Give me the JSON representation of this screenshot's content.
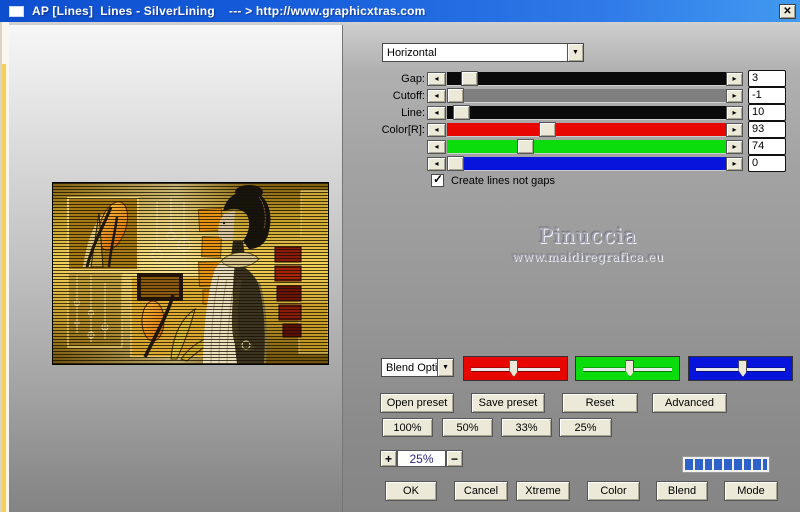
{
  "titlebar": {
    "title": "AP [Lines]  Lines - SilverLining    --- > http://www.graphicxtras.com",
    "close_glyph": "✕"
  },
  "mode_select": {
    "value": "Horizontal",
    "arrow_glyph": "▼"
  },
  "sliders": {
    "left_arrow_glyph": "◂",
    "right_arrow_glyph": "▸",
    "rows": [
      {
        "label": "Gap:",
        "value": "3",
        "color": "#0a0a0a",
        "thumb_left": "5%"
      },
      {
        "label": "Cutoff:",
        "value": "-1",
        "color": "#7f7f7f",
        "thumb_left": "0%"
      },
      {
        "label": "Line:",
        "value": "10",
        "color": "#0a0a0a",
        "thumb_left": "2%"
      },
      {
        "label": "Color[R]:",
        "value": "93",
        "color": "#e80600",
        "thumb_left": "33%"
      },
      {
        "label": "",
        "value": "74",
        "color": "#0bdc0b",
        "thumb_left": "25%"
      },
      {
        "label": "",
        "value": "0",
        "color": "#0614dc",
        "thumb_left": "0%"
      }
    ]
  },
  "options": {
    "create_lines_label": "Create lines not gaps",
    "checked": true,
    "check_glyph": "✓"
  },
  "watermark": {
    "name": "Pinuccia",
    "site": "www.maidiregrafica.eu"
  },
  "blend": {
    "select_value": "Blend Opti",
    "arrow_glyph": "▼",
    "channels": [
      {
        "name": "red",
        "color": "#e80600",
        "thumb_left": "44%"
      },
      {
        "name": "green",
        "color": "#0bdc0b",
        "thumb_left": "48%"
      },
      {
        "name": "blue",
        "color": "#0614dc",
        "thumb_left": "48%"
      }
    ]
  },
  "preset_buttons": {
    "open": "Open preset",
    "save": "Save preset",
    "reset": "Reset",
    "advanced": "Advanced"
  },
  "zoom_buttons": {
    "b100": "100%",
    "b50": "50%",
    "b33": "33%",
    "b25": "25%"
  },
  "zoom_control": {
    "plus": "+",
    "value": "25%",
    "minus": "−"
  },
  "progress": {
    "segments": 9
  },
  "action_buttons": {
    "ok": "OK",
    "cancel": "Cancel",
    "xtreme": "Xtreme",
    "color": "Color",
    "blend": "Blend",
    "mode": "Mode"
  }
}
